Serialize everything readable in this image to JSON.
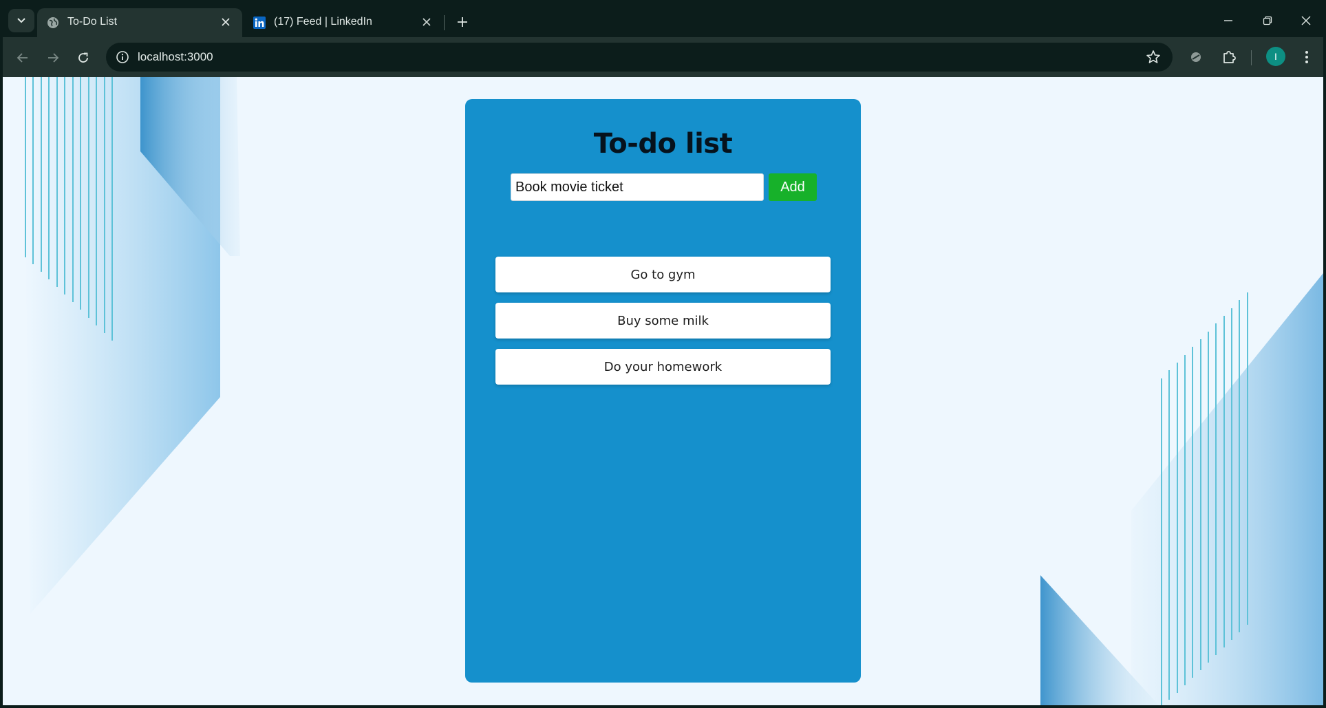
{
  "browser": {
    "tabs": [
      {
        "title": "To-Do List",
        "active": true,
        "favicon": "globe-icon"
      },
      {
        "title": "(17) Feed | LinkedIn",
        "active": false,
        "favicon": "linkedin-icon"
      }
    ],
    "address": "localhost:3000",
    "profile_initial": "I",
    "colors": {
      "chrome_dark": "#0c1d1b",
      "chrome_mid": "#233431",
      "avatar": "#0d8f83",
      "linkedin": "#0a66c2"
    }
  },
  "app": {
    "title": "To-do list",
    "input_value": "Book movie ticket",
    "add_label": "Add",
    "items": [
      {
        "text": "Go to gym"
      },
      {
        "text": "Buy some milk"
      },
      {
        "text": "Do your homework"
      }
    ],
    "colors": {
      "page_bg": "#eef7fe",
      "card": "#1590cc",
      "add_button": "#17b12a",
      "item_bg": "#ffffff"
    }
  }
}
